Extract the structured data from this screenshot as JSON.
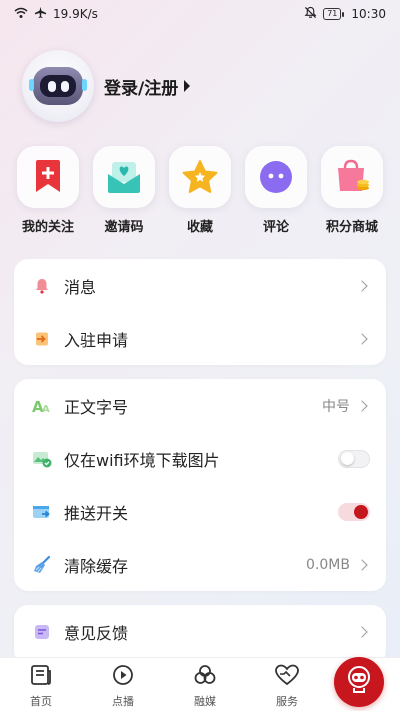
{
  "status_bar": {
    "speed": "19.9K/s",
    "battery": "71",
    "time": "10:30"
  },
  "profile": {
    "login_label": "登录/注册"
  },
  "quick": [
    {
      "label": "我的关注",
      "icon": "bookmark-plus-icon"
    },
    {
      "label": "邀请码",
      "icon": "envelope-heart-icon"
    },
    {
      "label": "收藏",
      "icon": "star-icon"
    },
    {
      "label": "评论",
      "icon": "chat-face-icon"
    },
    {
      "label": "积分商城",
      "icon": "shopping-bag-icon"
    }
  ],
  "card1": [
    {
      "label": "消息",
      "icon": "bell-icon"
    },
    {
      "label": "入驻申请",
      "icon": "enter-icon"
    }
  ],
  "card2": {
    "font_size": {
      "label": "正文字号",
      "value": "中号",
      "icon": "font-size-icon"
    },
    "wifi_images": {
      "label": "仅在wifi环境下载图片",
      "icon": "image-wifi-icon",
      "enabled": false
    },
    "push": {
      "label": "推送开关",
      "icon": "push-icon",
      "enabled": true
    },
    "cache": {
      "label": "清除缓存",
      "value": "0.0MB",
      "icon": "broom-icon"
    }
  },
  "card3": [
    {
      "label": "意见反馈",
      "icon": "feedback-icon"
    }
  ],
  "nav": [
    {
      "label": "首页",
      "icon": "home-doc-icon"
    },
    {
      "label": "点播",
      "icon": "play-circle-icon"
    },
    {
      "label": "融媒",
      "icon": "rings-icon"
    },
    {
      "label": "服务",
      "icon": "heart-hand-icon"
    }
  ],
  "colors": {
    "accent": "#c7161d",
    "toggle_on": "#c4181f"
  }
}
